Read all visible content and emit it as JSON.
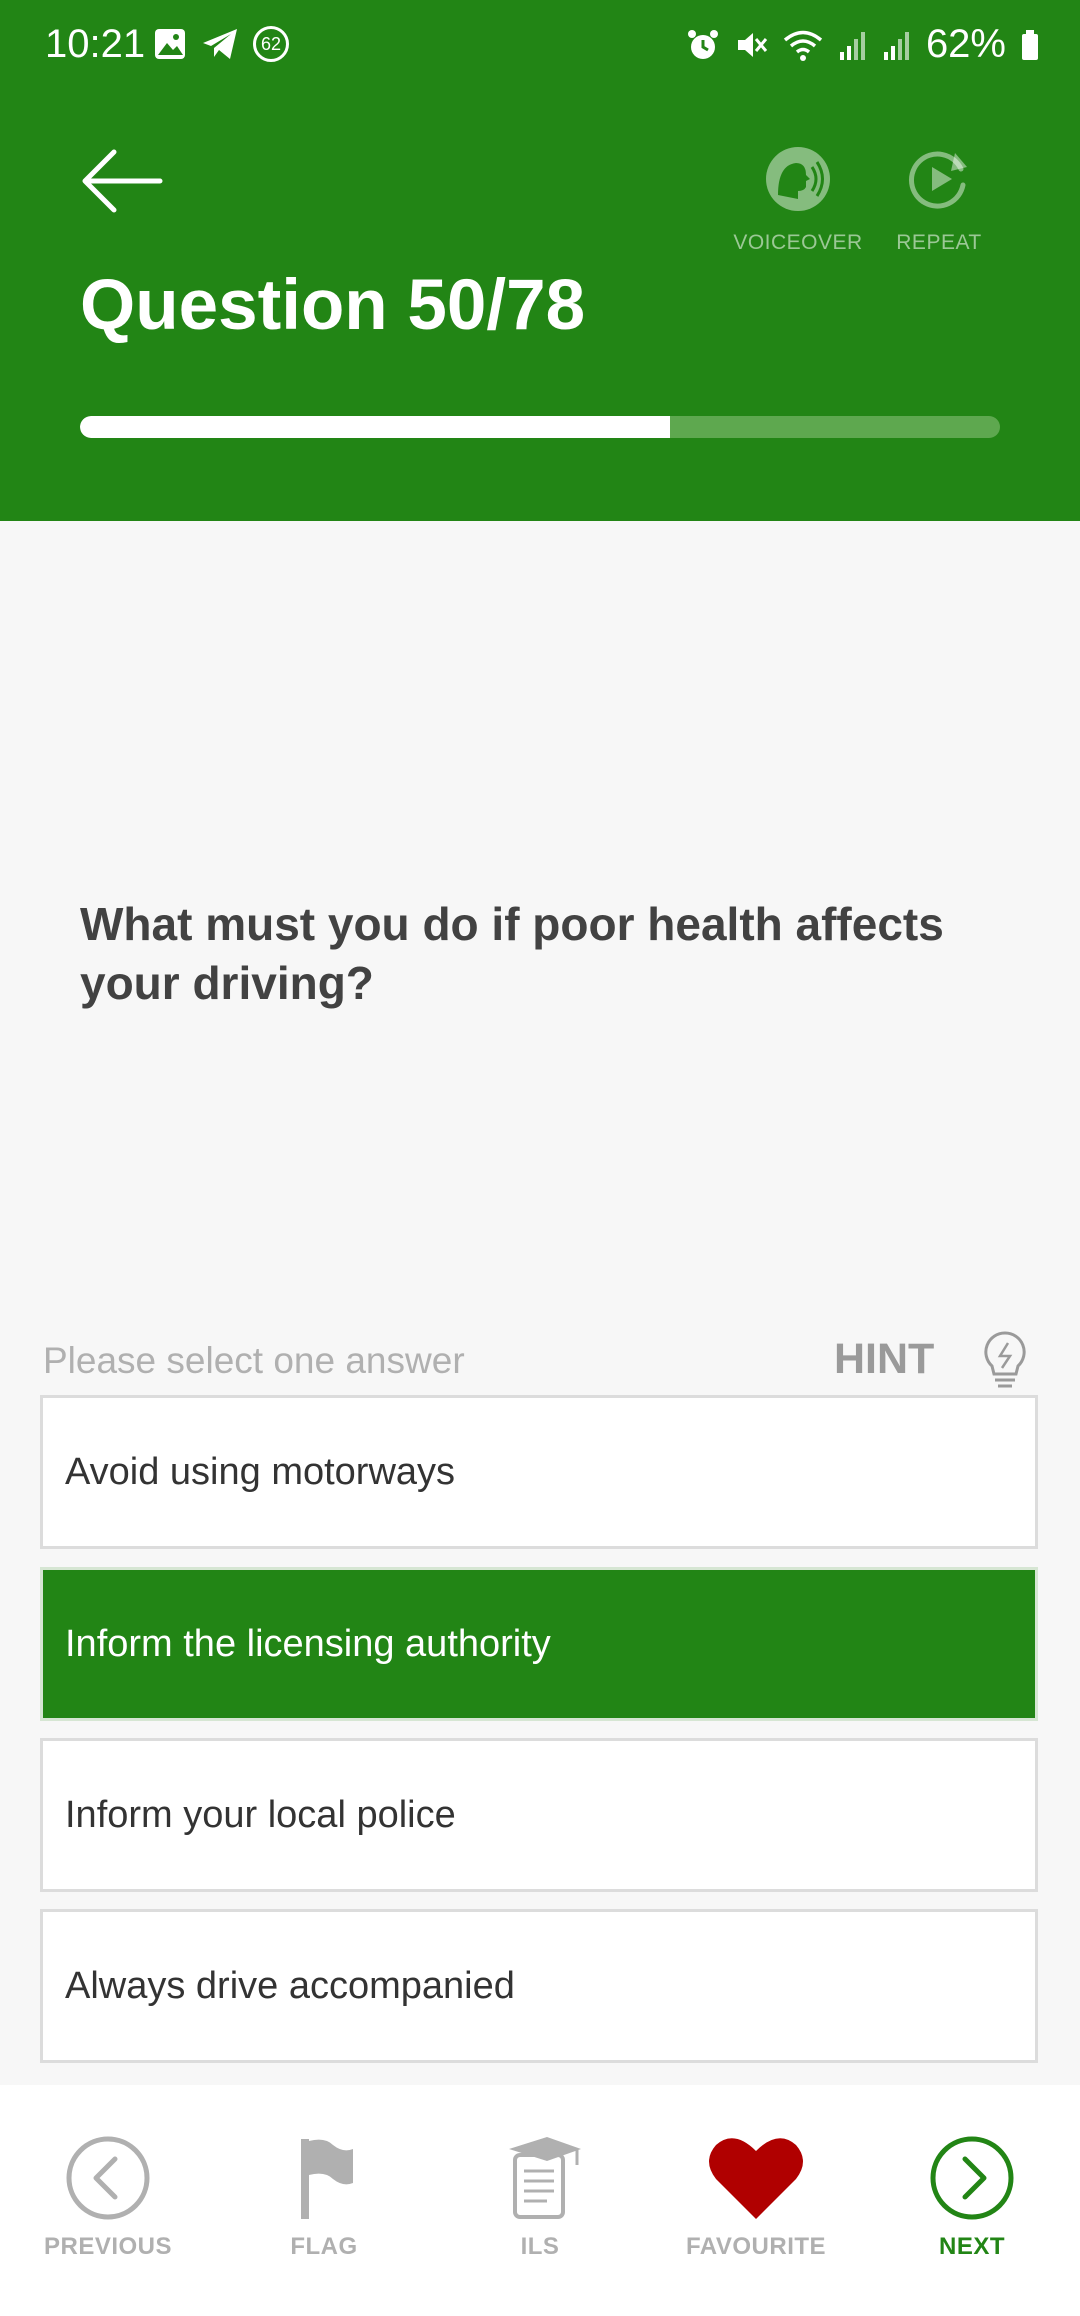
{
  "status_bar": {
    "time": "10:21",
    "notification_count": "62",
    "battery": "62%"
  },
  "header": {
    "title": "Question 50/78",
    "progress": 0.641,
    "voiceover_label": "VOICEOVER",
    "repeat_label": "REPEAT"
  },
  "question": {
    "text": "What must you do if poor health affects your driving?"
  },
  "answers_section": {
    "prompt": "Please select one answer",
    "hint_label": "HINT"
  },
  "answers": [
    {
      "label": "Avoid using motorways",
      "selected": false
    },
    {
      "label": "Inform the licensing authority",
      "selected": true
    },
    {
      "label": "Inform your local police",
      "selected": false
    },
    {
      "label": "Always drive accompanied",
      "selected": false
    }
  ],
  "bottom_nav": {
    "previous": "PREVIOUS",
    "flag": "FLAG",
    "ils": "ILS",
    "favourite": "FAVOURITE",
    "next": "NEXT"
  },
  "colors": {
    "brand_green": "#228515",
    "favourite_red": "#b00000"
  }
}
